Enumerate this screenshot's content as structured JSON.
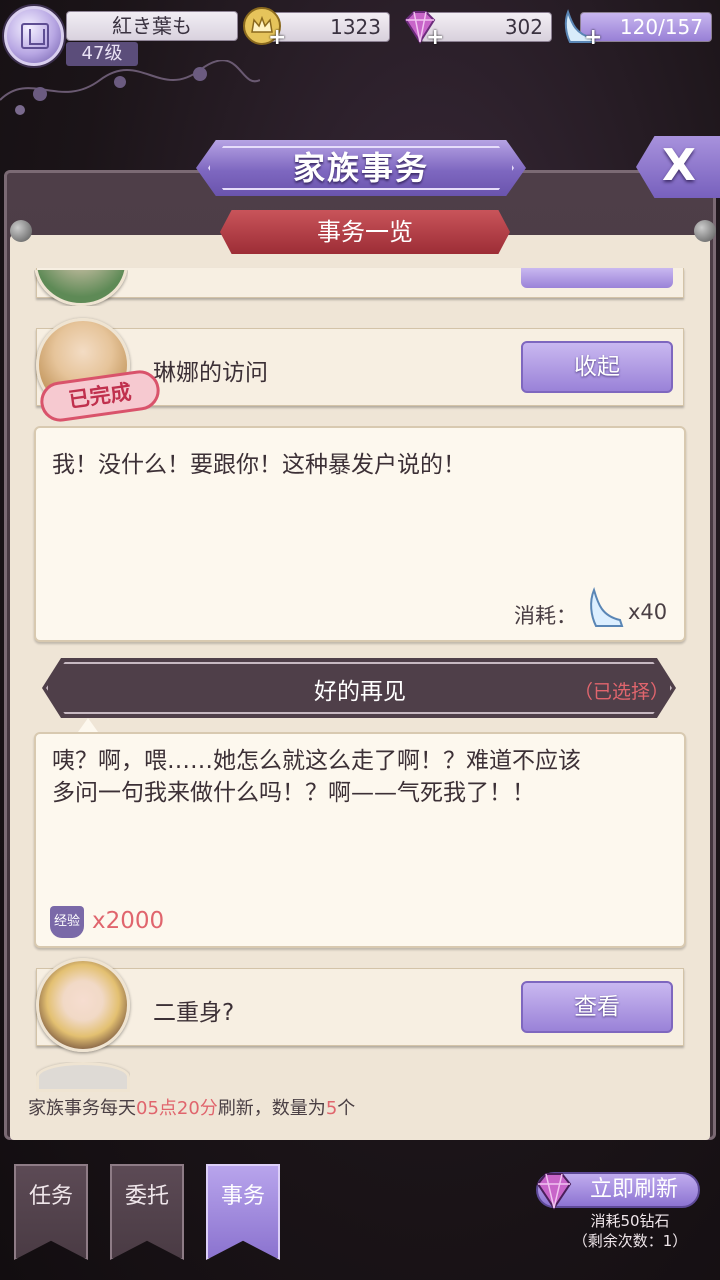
{
  "player": {
    "name": "紅き葉も",
    "level": "47级"
  },
  "resources": {
    "gold": "1323",
    "diamonds": "302",
    "stamina": "120/157"
  },
  "header": {
    "title": "家族事务",
    "close_label": "X",
    "subtitle": "事务一览"
  },
  "events": [
    {
      "title": "琳娜的访问",
      "status": "已完成",
      "button": "收起"
    },
    {
      "title": "二重身?",
      "button": "查看"
    }
  ],
  "dialog": {
    "line1": "我！没什么！要跟你！这种暴发户说的！",
    "cost_label": "消耗：",
    "cost_amount": "x40",
    "choice": "好的再见",
    "choice_selected": "（已选择）",
    "response_line1": "咦？啊，喂……她怎么就这么走了啊！？难道不应该",
    "response_line2": "多问一句我来做什么吗！？啊——气死我了！！",
    "reward_badge": "经验",
    "reward_amount": "x2000"
  },
  "footer": {
    "note_prefix": "家族事务每天",
    "note_time": "05点20分",
    "note_mid": "刷新，数量为",
    "note_count": "5",
    "note_suffix": "个"
  },
  "bottom_nav": {
    "tabs": [
      "任务",
      "委托",
      "事务"
    ],
    "active_tab": "事务",
    "refresh_label": "立即刷新",
    "refresh_cost": "消耗50钻石",
    "refresh_remaining": "（剩余次数：1）"
  },
  "colors": {
    "accent_purple": "#9a82d8",
    "highlight_red": "#e0656d",
    "banner_red": "#9d2d36",
    "paper": "#efe5d6"
  }
}
